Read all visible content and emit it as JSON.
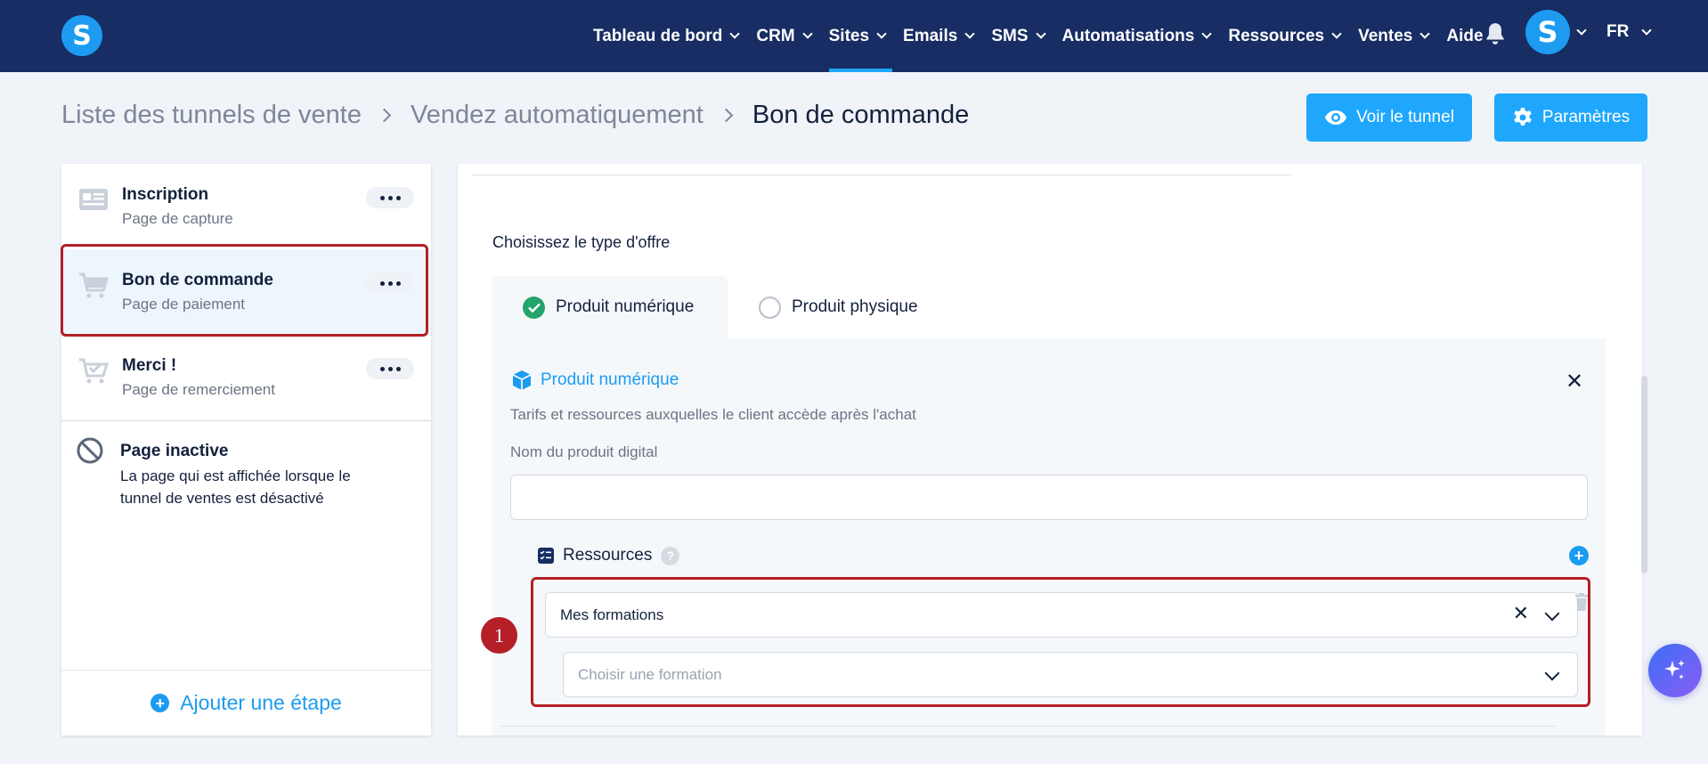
{
  "nav": {
    "items": [
      {
        "label": "Tableau de bord",
        "chevron": true
      },
      {
        "label": "CRM",
        "chevron": true
      },
      {
        "label": "Sites",
        "chevron": true,
        "active": true
      },
      {
        "label": "Emails",
        "chevron": true
      },
      {
        "label": "SMS",
        "chevron": true
      },
      {
        "label": "Automatisations",
        "chevron": true
      },
      {
        "label": "Ressources",
        "chevron": true
      },
      {
        "label": "Ventes",
        "chevron": true
      },
      {
        "label": "Aide",
        "chevron": false
      }
    ],
    "logo_letter": "S",
    "avatar_letter": "S",
    "language": "FR",
    "bar_color": "#172d63",
    "accent_color": "#1ea7fd"
  },
  "breadcrumb": {
    "level1": "Liste des tunnels de vente",
    "level2": "Vendez automatiquement",
    "current": "Bon de commande"
  },
  "actions": {
    "view_funnel": "Voir le tunnel",
    "settings": "Paramètres"
  },
  "sidebar": {
    "steps": [
      {
        "title": "Inscription",
        "subtitle": "Page de capture",
        "icon": "form-page-icon"
      },
      {
        "title": "Bon de commande",
        "subtitle": "Page de paiement",
        "icon": "cart-icon",
        "selected": true
      },
      {
        "title": "Merci !",
        "subtitle": "Page de remerciement",
        "icon": "cart-check-icon"
      }
    ],
    "inactive": {
      "title": "Page inactive",
      "description": "La page qui est affichée lorsque le tunnel de ventes est désactivé"
    },
    "add_step": "Ajouter une étape"
  },
  "main": {
    "offer_type_label": "Choisissez le type d'offre",
    "tabs": [
      {
        "label": "Produit numérique",
        "selected": true
      },
      {
        "label": "Produit physique",
        "selected": false
      }
    ],
    "product": {
      "title": "Produit numérique",
      "description": "Tarifs et ressources auxquelles le client accède après l'achat",
      "name_label": "Nom du produit digital",
      "name_value": "",
      "resources_label": "Ressources",
      "resource_type_value": "Mes formations",
      "formation_placeholder": "Choisir une formation"
    }
  },
  "annotation": {
    "badge_number": "1",
    "color": "#b51f28"
  }
}
